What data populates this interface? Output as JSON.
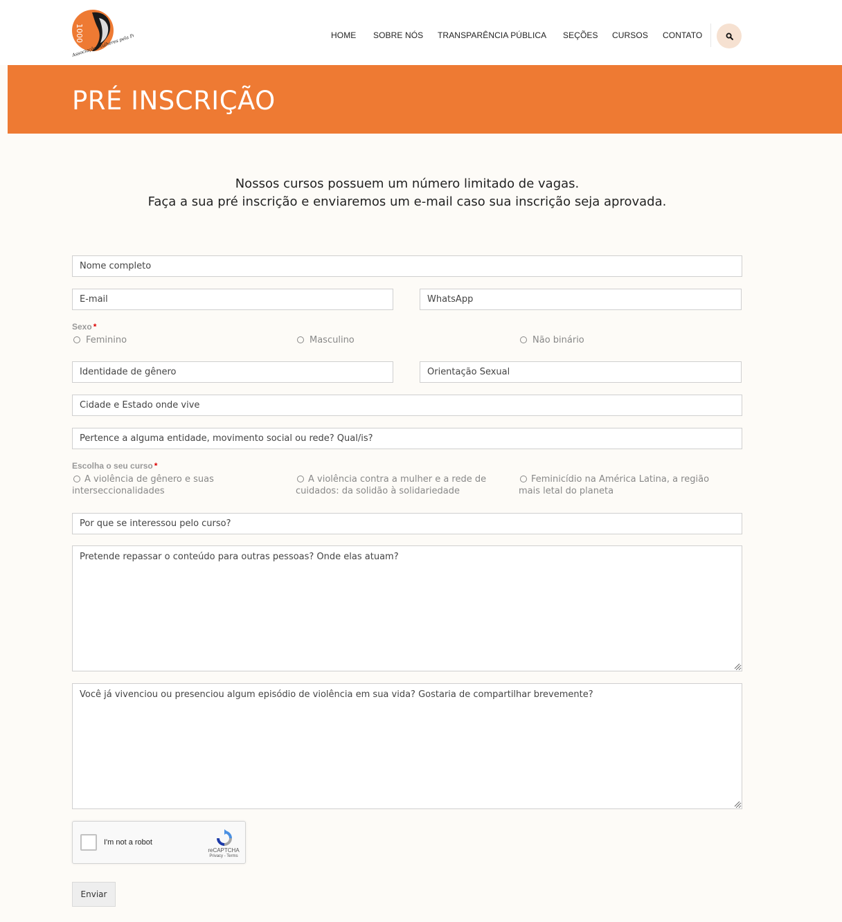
{
  "header": {
    "logo_text": "1000 Associação Mulheres pela Paz",
    "nav": [
      {
        "label": "HOME"
      },
      {
        "label": "SOBRE NÓS"
      },
      {
        "label": "TRANSPARÊNCIA PÚBLICA"
      },
      {
        "label": "SEÇÕES"
      },
      {
        "label": "CURSOS"
      },
      {
        "label": "CONTATO"
      }
    ],
    "search_icon": "search-icon"
  },
  "banner": {
    "title": "PRÉ INSCRIÇÃO"
  },
  "intro": {
    "line1": "Nossos cursos possuem um número limitado de vagas.",
    "line2": "Faça a sua pré inscrição e enviaremos um e-mail caso sua inscrição seja aprovada."
  },
  "form": {
    "nome": {
      "placeholder": "Nome completo",
      "value": ""
    },
    "email": {
      "placeholder": "E-mail",
      "value": ""
    },
    "whatsapp": {
      "placeholder": "WhatsApp",
      "value": ""
    },
    "sexo": {
      "label": "Sexo",
      "required_mark": "*",
      "options": [
        "Feminino",
        "Masculino",
        "Não binário"
      ]
    },
    "identidade": {
      "placeholder": "Identidade de gênero",
      "value": ""
    },
    "orientacao": {
      "placeholder": "Orientação Sexual",
      "value": ""
    },
    "cidade": {
      "placeholder": "Cidade e Estado onde vive",
      "value": ""
    },
    "entidade": {
      "placeholder": "Pertence a alguma entidade, movimento social ou rede? Qual/is?",
      "value": ""
    },
    "curso": {
      "label": "Escolha o seu curso",
      "required_mark": "*",
      "options": [
        "A violência de gênero e suas interseccionalidades",
        "A violência contra a mulher e a rede de cuidados: da solidão à solidariedade",
        "Feminicídio na América Latina, a região mais letal do planeta"
      ]
    },
    "interesse": {
      "placeholder": "Por que se interessou pelo curso?",
      "value": ""
    },
    "repassar": {
      "placeholder": "Pretende repassar o conteúdo para outras pessoas? Onde elas atuam?",
      "value": ""
    },
    "violencia": {
      "placeholder": "Você já vivenciou ou presenciou algum episódio de violência em sua vida? Gostaria de compartilhar brevemente?",
      "value": ""
    },
    "captcha": {
      "label": "I'm not a robot",
      "brand": "reCAPTCHA",
      "links": "Privacy - Terms"
    },
    "submit_label": "Enviar"
  },
  "colors": {
    "accent": "#ee7a33",
    "background": "#fdfbf7",
    "search_bg": "#f6e1d1"
  }
}
